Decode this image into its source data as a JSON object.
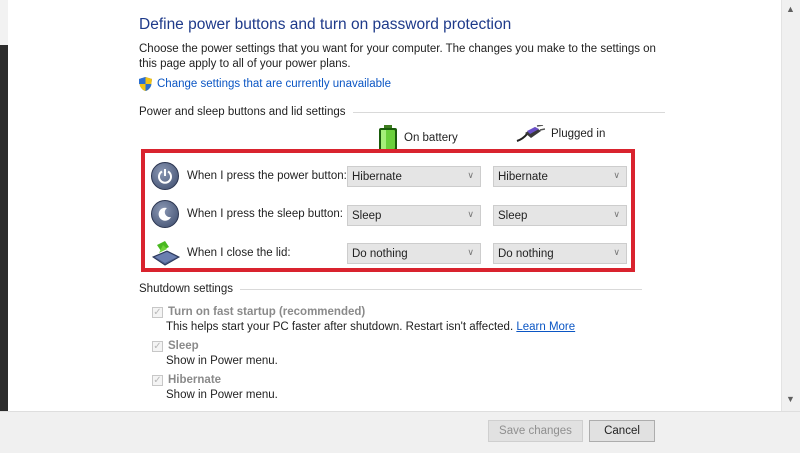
{
  "page": {
    "title": "Define power buttons and turn on password protection",
    "description": "Choose the power settings that you want for your computer. The changes you make to the settings on this page apply to all of your power plans.",
    "change_settings_link": "Change settings that are currently unavailable"
  },
  "power_section": {
    "header": "Power and sleep buttons and lid settings",
    "col_battery": "On battery",
    "col_plugged": "Plugged in",
    "rows": [
      {
        "label": "When I press the power button:",
        "battery": "Hibernate",
        "plugged": "Hibernate",
        "icon": "power-button-icon"
      },
      {
        "label": "When I press the sleep button:",
        "battery": "Sleep",
        "plugged": "Sleep",
        "icon": "sleep-button-icon"
      },
      {
        "label": "When I close the lid:",
        "battery": "Do nothing",
        "plugged": "Do nothing",
        "icon": "laptop-lid-icon"
      }
    ]
  },
  "shutdown_section": {
    "header": "Shutdown settings",
    "items": [
      {
        "label": "Turn on fast startup (recommended)",
        "desc": "This helps start your PC faster after shutdown. Restart isn't affected.",
        "link": "Learn More",
        "checked": true
      },
      {
        "label": "Sleep",
        "desc": "Show in Power menu.",
        "checked": true
      },
      {
        "label": "Hibernate",
        "desc": "Show in Power menu.",
        "checked": true
      }
    ]
  },
  "buttons": {
    "save": "Save changes",
    "cancel": "Cancel"
  },
  "colors": {
    "highlight_box": "#d9232e",
    "title": "#1e3a8a",
    "link": "#0b56c4"
  }
}
